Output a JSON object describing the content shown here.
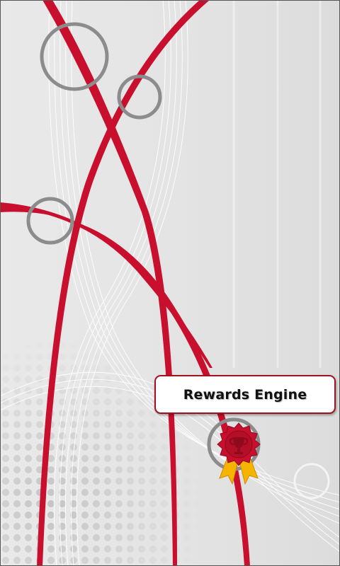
{
  "splash": {
    "app_title": "Rewards Engine"
  },
  "theme": {
    "accent": "#c8102e",
    "ring": "#8a8a8a",
    "background": "#e6e6e6"
  },
  "icons": {
    "badge": "award-ribbon-icon"
  }
}
